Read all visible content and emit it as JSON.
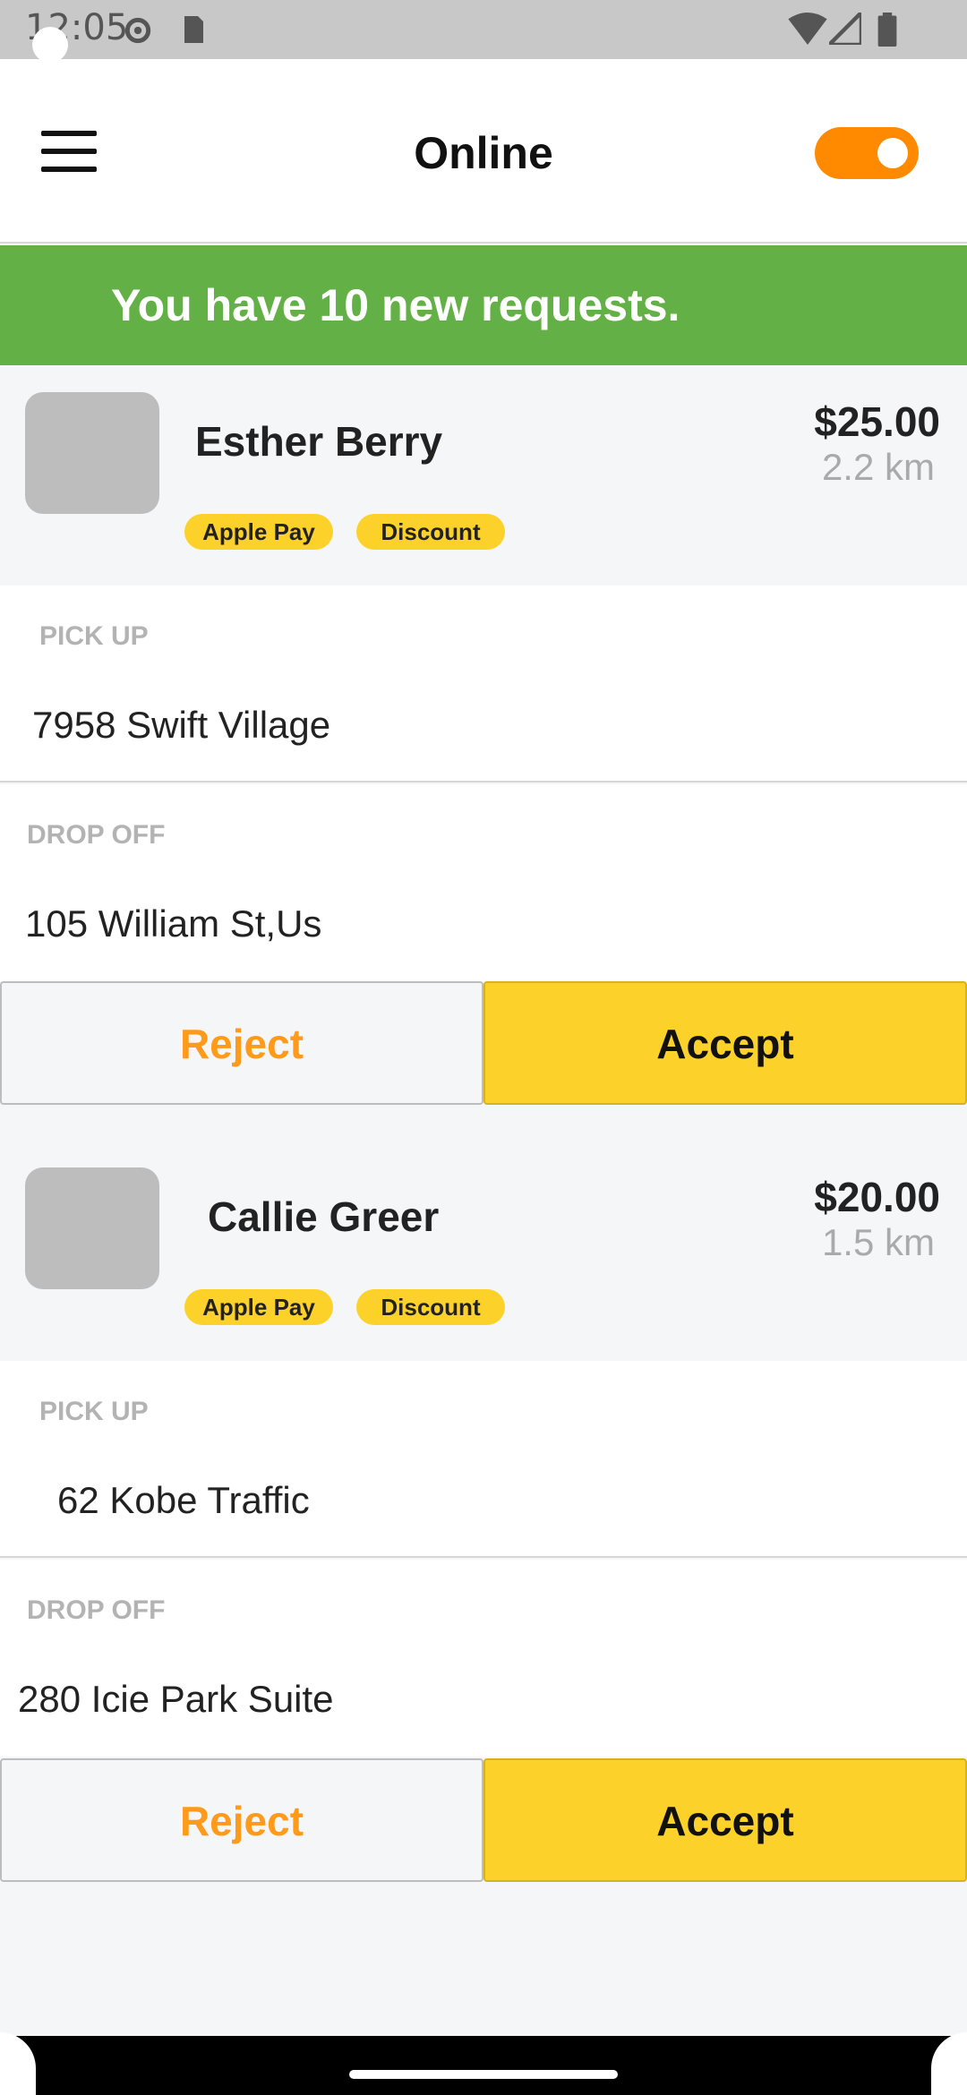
{
  "status_bar": {
    "time": "12:05",
    "icons": [
      "settings-icon",
      "sd-card-icon",
      "wifi-icon",
      "signal-icon",
      "battery-icon"
    ]
  },
  "header": {
    "title": "Online",
    "menu_icon": "hamburger-menu-icon",
    "online_toggle": true
  },
  "banner": {
    "text": "You have 10 new requests."
  },
  "requests": [
    {
      "name": "Esther Berry",
      "fare": "$25.00",
      "distance": "2.2 km",
      "tags": [
        "Apple Pay",
        "Discount"
      ],
      "pickup_label": "PICK UP",
      "pickup": "7958 Swift Village",
      "dropoff_label": "DROP OFF",
      "dropoff": "105 William St,Us",
      "reject_label": "Reject",
      "accept_label": "Accept"
    },
    {
      "name": "Callie Greer",
      "fare": "$20.00",
      "distance": "1.5 km",
      "tags": [
        "Apple Pay",
        "Discount"
      ],
      "pickup_label": "PICK UP",
      "pickup": "62 Kobe Traffic",
      "dropoff_label": "DROP OFF",
      "dropoff": "280 Icie Park Suite",
      "reject_label": "Reject",
      "accept_label": "Accept"
    }
  ],
  "colors": {
    "accent_orange": "#ff8a00",
    "accept_yellow": "#fcd22a",
    "banner_green": "#63b046",
    "reject_text": "#ff9a1a"
  }
}
